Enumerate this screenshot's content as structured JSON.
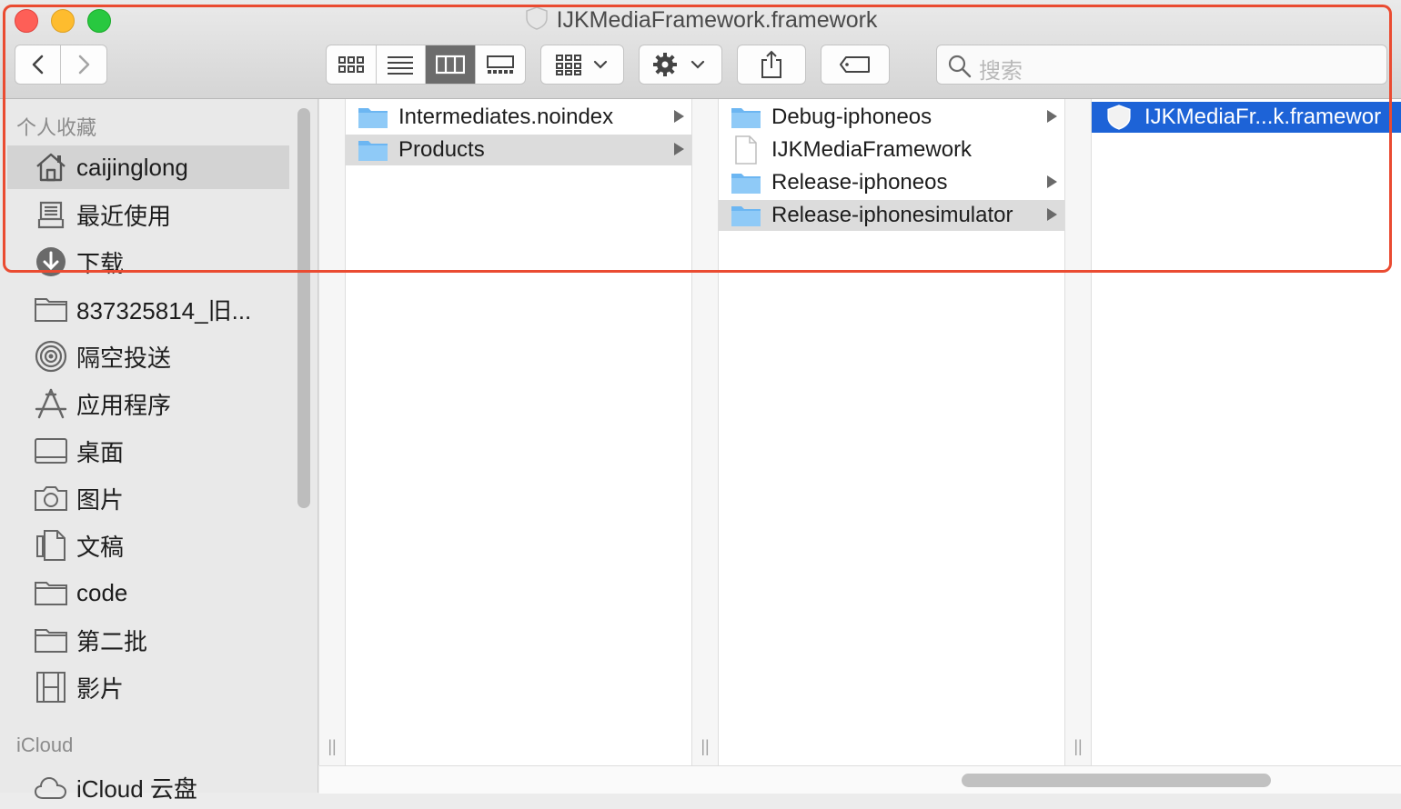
{
  "window": {
    "title": "IJKMediaFramework.framework"
  },
  "toolbar": {
    "back_icon": "chevron-left-icon",
    "forward_icon": "chevron-right-icon",
    "view_modes": [
      "icon-view",
      "list-view",
      "column-view",
      "gallery-view"
    ],
    "active_view": "column-view",
    "search_placeholder": "搜索"
  },
  "sidebar": {
    "favorites_header": "个人收藏",
    "items": [
      {
        "label": "caijinglong",
        "icon": "home-icon",
        "selected": true
      },
      {
        "label": "最近使用",
        "icon": "recents-icon"
      },
      {
        "label": "下载",
        "icon": "downloads-icon"
      },
      {
        "label": "837325814_旧...",
        "icon": "folder-icon"
      },
      {
        "label": "隔空投送",
        "icon": "airdrop-icon"
      },
      {
        "label": "应用程序",
        "icon": "applications-icon"
      },
      {
        "label": "桌面",
        "icon": "desktop-icon"
      },
      {
        "label": "图片",
        "icon": "camera-icon"
      },
      {
        "label": "文稿",
        "icon": "documents-icon"
      },
      {
        "label": "code",
        "icon": "folder-icon"
      },
      {
        "label": "第二批",
        "icon": "folder-icon"
      },
      {
        "label": "影片",
        "icon": "film-icon"
      }
    ],
    "icloud_header": "iCloud",
    "icloud_items": [
      {
        "label": "iCloud 云盘",
        "icon": "cloud-icon"
      }
    ]
  },
  "columns": [
    {
      "rows": [
        {
          "name": "Intermediates.noindex",
          "type": "folder",
          "has_children": true
        },
        {
          "name": "Products",
          "type": "folder",
          "has_children": true,
          "highlighted": true
        }
      ]
    },
    {
      "rows": [
        {
          "name": "Debug-iphoneos",
          "type": "folder",
          "has_children": true
        },
        {
          "name": "IJKMediaFramework",
          "type": "file",
          "has_children": false
        },
        {
          "name": "Release-iphoneos",
          "type": "folder",
          "has_children": true
        },
        {
          "name": "Release-iphonesimulator",
          "type": "folder",
          "has_children": true,
          "highlighted": true
        }
      ]
    },
    {
      "rows": [
        {
          "name": "IJKMediaFr...k.framewor",
          "type": "framework",
          "selected": true
        }
      ]
    }
  ],
  "colors": {
    "selection": "#1d63d7",
    "annotation": "#ea4b31",
    "folder": "#6cb6f2"
  }
}
